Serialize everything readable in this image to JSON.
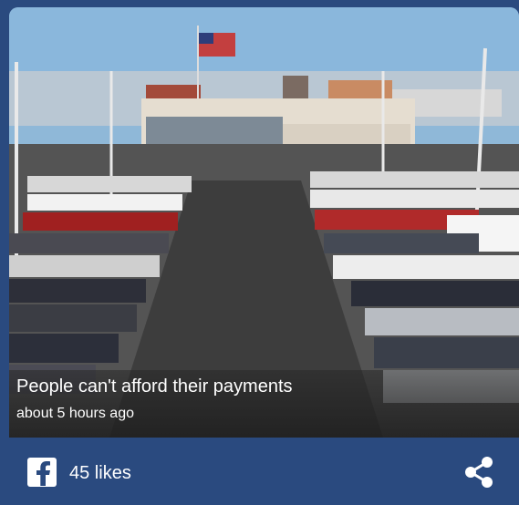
{
  "article": {
    "headline": "People can't afford their payments",
    "timestamp": "about 5 hours ago",
    "image_alt": "car-dealership-lot-photo"
  },
  "footer": {
    "likes_label": "45 likes",
    "facebook_icon": "facebook-icon",
    "share_icon": "share-icon"
  },
  "colors": {
    "card_background": "#2a4a7f",
    "text": "#ffffff"
  }
}
